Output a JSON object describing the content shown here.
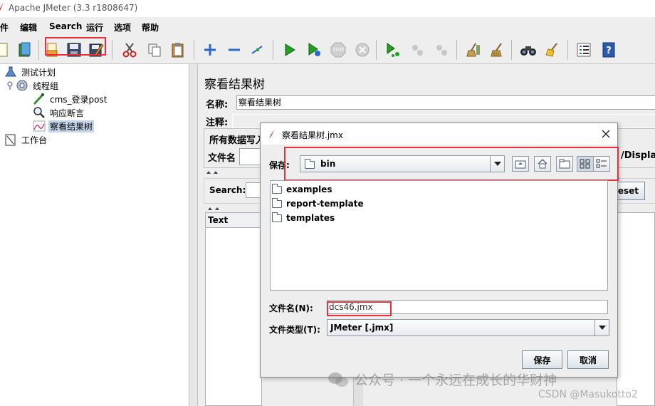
{
  "window": {
    "title": "Apache JMeter (3.3 r1808647)"
  },
  "menubar": {
    "items": [
      "件",
      "编辑",
      "Search",
      "运行",
      "选项",
      "帮助"
    ]
  },
  "toolbar": {
    "icons": [
      "new-icon",
      "templates-icon",
      "open-icon",
      "save-icon",
      "save-as-icon",
      "cut-icon",
      "copy-icon",
      "paste-icon",
      "expand-icon",
      "collapse-icon",
      "toggle-icon",
      "start-icon",
      "start-no-pause-icon",
      "stop-icon",
      "shutdown-icon",
      "remote-start-icon",
      "remote-stop-icon",
      "remote-shutdown-icon",
      "clear-icon",
      "clear-all-icon",
      "search-icon",
      "reset-search-icon",
      "function-helper-icon",
      "help-icon"
    ]
  },
  "tree": {
    "items": [
      {
        "label": "测试计划",
        "icon": "test-plan-icon"
      },
      {
        "label": "线程组",
        "icon": "thread-group-icon"
      },
      {
        "label": "cms_登录post",
        "icon": "sampler-icon"
      },
      {
        "label": "响应断言",
        "icon": "assertion-icon"
      },
      {
        "label": "察看结果树",
        "icon": "listener-icon"
      },
      {
        "label": "工作台",
        "icon": "workbench-icon"
      }
    ]
  },
  "main": {
    "title": "察看结果树",
    "name_label": "名称:",
    "name_value": "察看结果树",
    "comment_label": "注释:",
    "group_title": "所有数据写入",
    "filename_label": "文件名",
    "display_text": "/Display",
    "search_label": "Search:",
    "reset_label": "eset",
    "text_col": "Text"
  },
  "dialog": {
    "title": "察看结果树.jmx",
    "save_in_label": "保存:",
    "location": "bin",
    "files": [
      "examples",
      "report-template",
      "templates"
    ],
    "filename_label": "文件名(N):",
    "filename_value": "dcs46.jmx",
    "filetype_label": "文件类型(T):",
    "filetype_value": "JMeter [.jmx]",
    "save_button": "保存",
    "cancel_button": "取消"
  },
  "watermark": {
    "text": "公众号 · 一个永远在成长的华财神",
    "csdn": "CSDN @Masukotto2"
  },
  "colors": {
    "highlight": "#e8303a",
    "selection": "#c4d4ea"
  }
}
